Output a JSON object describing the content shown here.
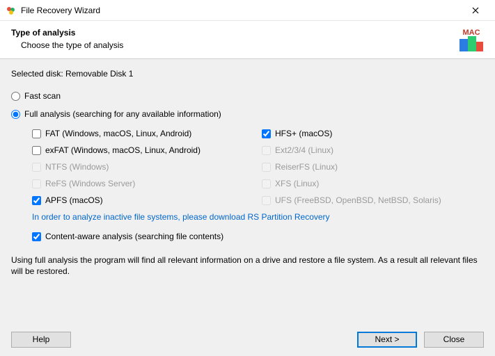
{
  "window": {
    "title": "File Recovery Wizard"
  },
  "header": {
    "title": "Type of analysis",
    "subtitle": "Choose the type of analysis"
  },
  "selected_disk_label": "Selected disk: Removable Disk 1",
  "scan": {
    "fast_label": "Fast scan",
    "full_label": "Full analysis (searching for any available information)"
  },
  "fs": {
    "fat": "FAT (Windows, macOS, Linux, Android)",
    "exfat": "exFAT (Windows, macOS, Linux, Android)",
    "ntfs": "NTFS (Windows)",
    "refs": "ReFS (Windows Server)",
    "apfs": "APFS (macOS)",
    "hfs": "HFS+ (macOS)",
    "ext": "Ext2/3/4 (Linux)",
    "reiser": "ReiserFS (Linux)",
    "xfs": "XFS (Linux)",
    "ufs": "UFS (FreeBSD, OpenBSD, NetBSD, Solaris)"
  },
  "link_text": "In order to analyze inactive file systems, please download RS Partition Recovery",
  "content_aware_label": "Content-aware analysis (searching file contents)",
  "description": "Using full analysis the program will find all relevant information on a drive and restore a file system. As a result all relevant files will be restored.",
  "buttons": {
    "help": "Help",
    "next": "Next >",
    "close": "Close"
  },
  "logo_text": "MAC"
}
